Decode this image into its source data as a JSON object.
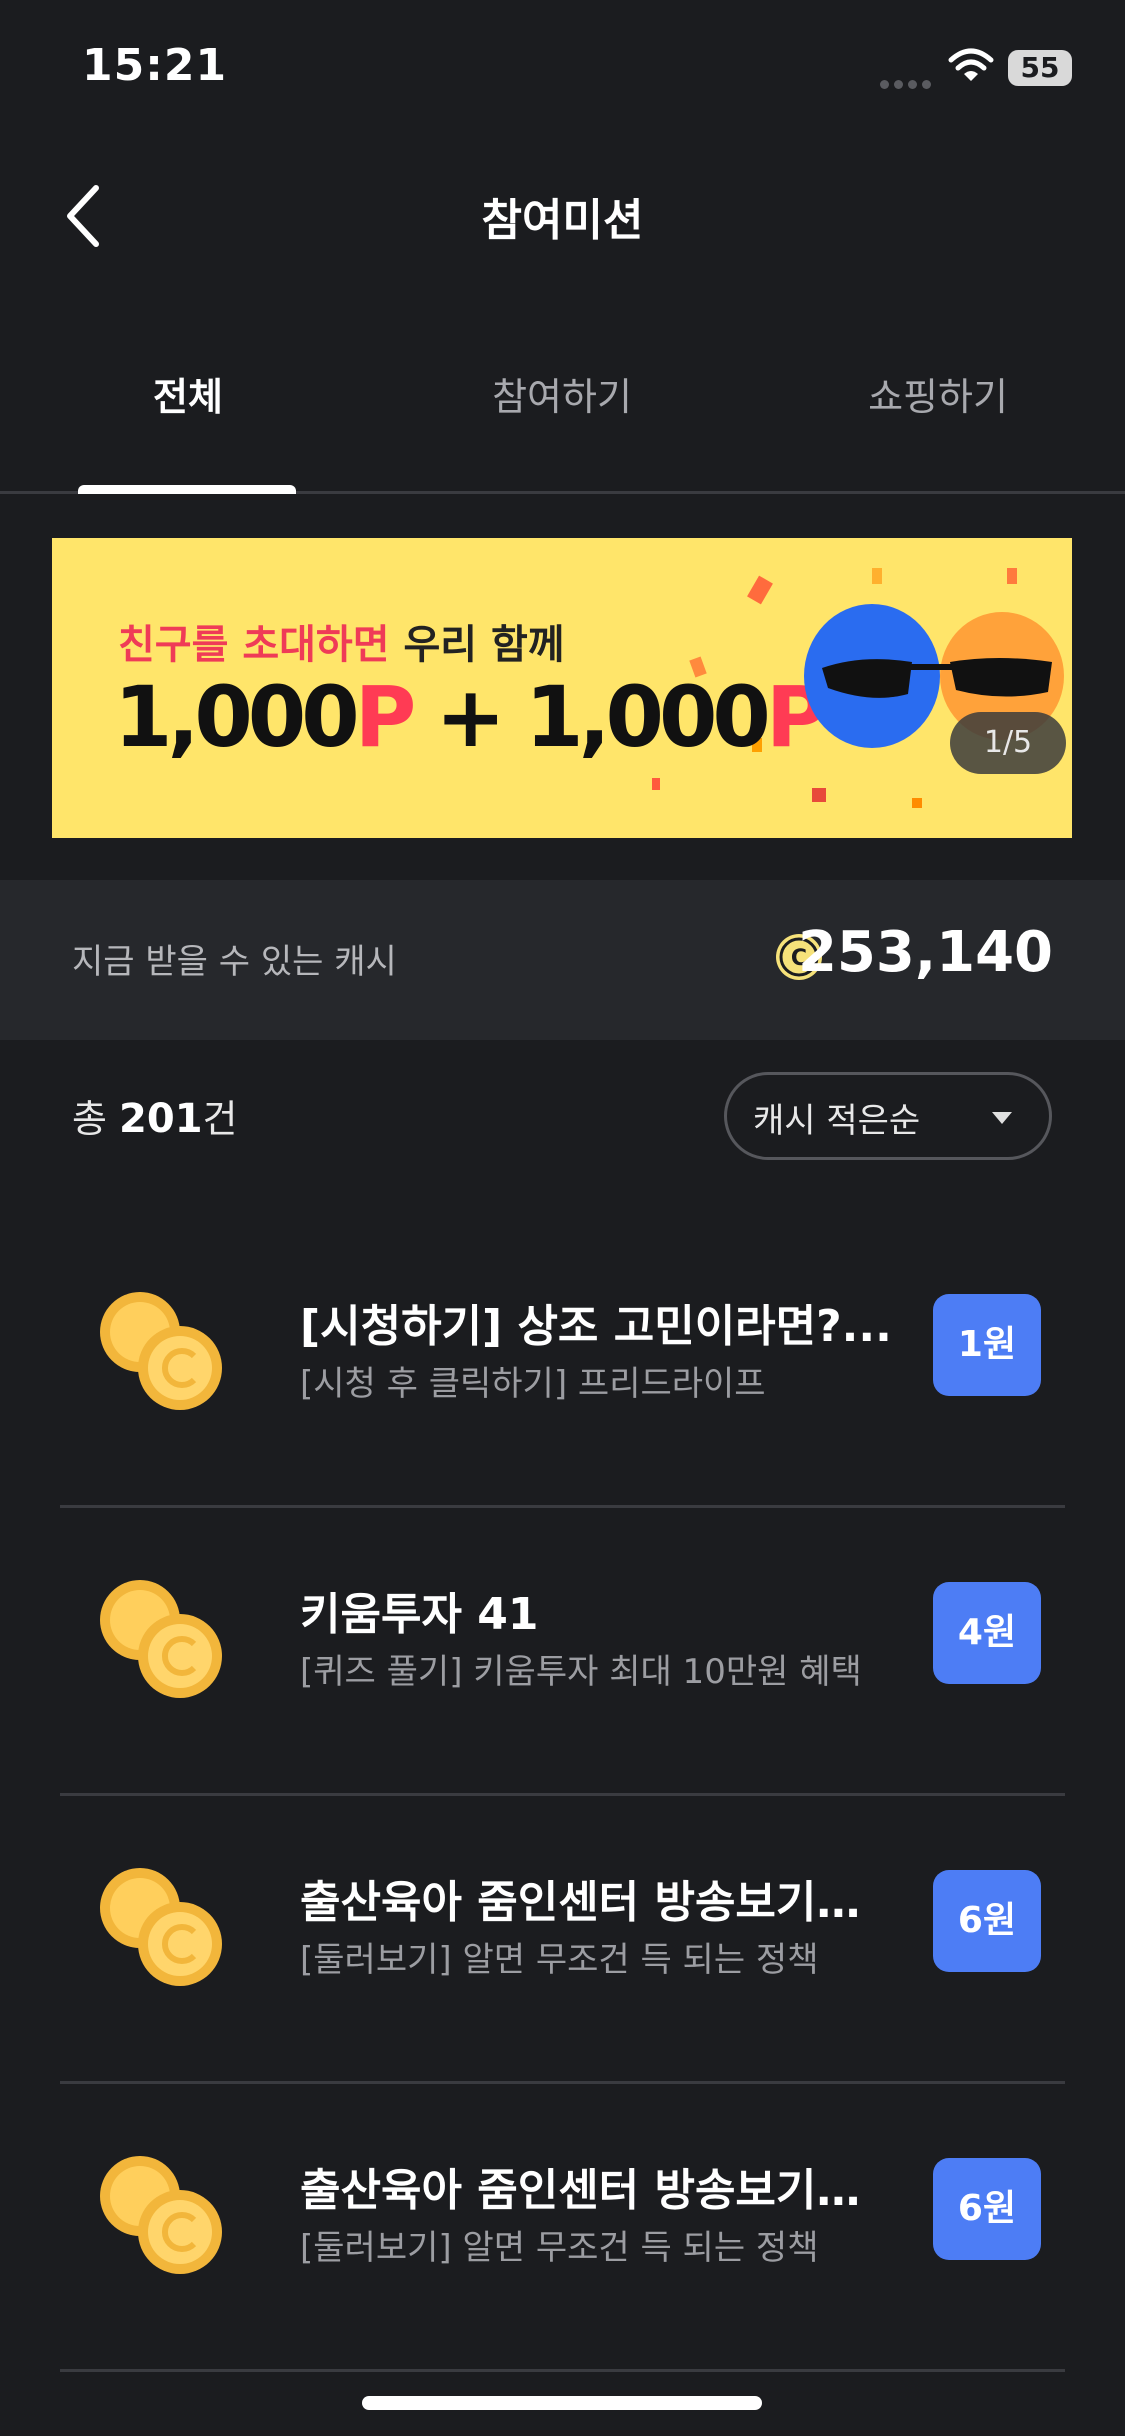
{
  "status_bar": {
    "time": "15:21",
    "battery": "55"
  },
  "header": {
    "title": "참여미션"
  },
  "tabs": [
    {
      "label": "전체",
      "active": true
    },
    {
      "label": "참여하기",
      "active": false
    },
    {
      "label": "쇼핑하기",
      "active": false
    }
  ],
  "banner": {
    "subtitle_red": "친구를 초대하면",
    "subtitle_dark": "우리 함께",
    "main_a": "1,000",
    "main_a_unit": "P",
    "main_plus": " + ",
    "main_b": "1,000",
    "main_b_unit": "P",
    "counter": "1/5"
  },
  "cash": {
    "label": "지금 받을 수 있는 캐시",
    "amount": "253,140",
    "coin_icon_letter": "C"
  },
  "list_header": {
    "count_prefix": "총 ",
    "count_value": "201",
    "count_suffix": "건",
    "sort_label": "캐시 적은순"
  },
  "missions": [
    {
      "title": "[시청하기] 상조 고민이라면?...",
      "desc": "[시청 후 클릭하기] 프리드라이프",
      "reward": "1원"
    },
    {
      "title": "키움투자 41",
      "desc": "[퀴즈 풀기] 키움투자 최대 10만원 혜택",
      "reward": "4원"
    },
    {
      "title": "출산육아 줌인센터 방송보기…",
      "desc": "[둘러보기] 알면 무조건 득 되는 정책",
      "reward": "6원"
    },
    {
      "title": "출산육아 줌인센터 방송보기…",
      "desc": "[둘러보기] 알면 무조건 득 되는 정책",
      "reward": "6원"
    }
  ],
  "colors": {
    "background": "#1b1c1f",
    "accent": "#4d7df5",
    "banner": "#ffe56a",
    "banner_red": "#ff3b54",
    "coin": "#f5c04a"
  }
}
